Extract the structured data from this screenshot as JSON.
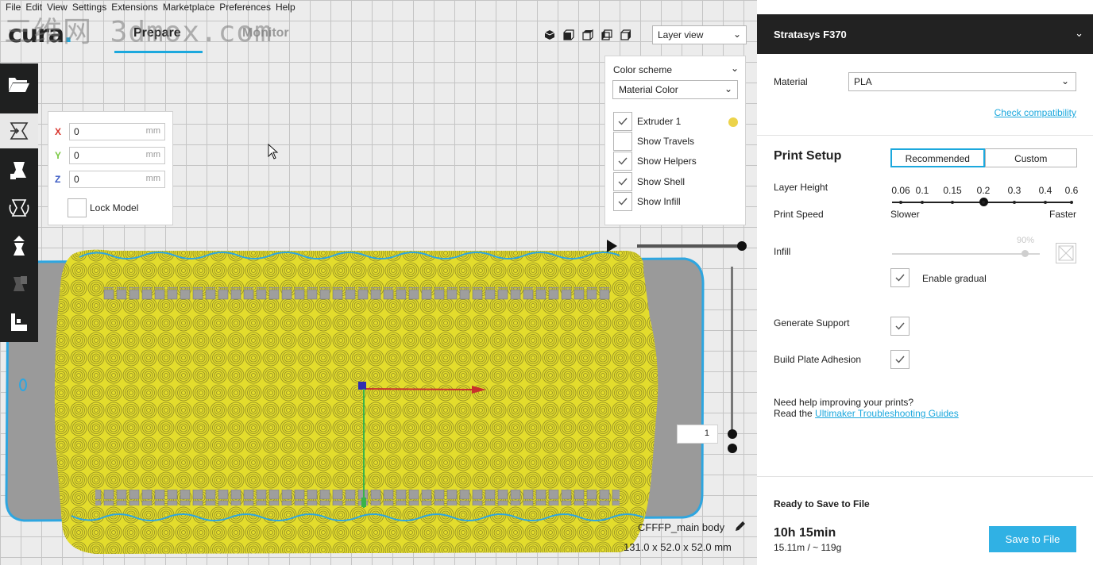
{
  "menu": [
    "File",
    "Edit",
    "View",
    "Settings",
    "Extensions",
    "Marketplace",
    "Preferences",
    "Help"
  ],
  "watermark": "三维网 3dmox.com",
  "header": {
    "logo": "cura",
    "tabs": [
      {
        "label": "Prepare",
        "active": true
      },
      {
        "label": "Monitor",
        "active": false
      }
    ],
    "view_mode": "Layer view",
    "view_buttons": [
      "3d-view-icon",
      "front-view-icon",
      "top-view-icon",
      "left-view-icon",
      "right-view-icon"
    ]
  },
  "toolbar": {
    "items": [
      "open-folder-icon",
      "move-tool-icon",
      "scale-tool-icon",
      "rotate-tool-icon",
      "mirror-tool-icon",
      "per-model-settings-icon",
      "support-blocker-icon"
    ]
  },
  "move_panel": {
    "x": {
      "label": "X",
      "value": "0",
      "unit": "mm",
      "color": "#d8342c"
    },
    "y": {
      "label": "Y",
      "value": "0",
      "unit": "mm",
      "color": "#7ac943"
    },
    "z": {
      "label": "Z",
      "value": "0",
      "unit": "mm",
      "color": "#3b5bc4"
    },
    "lock_label": "Lock Model",
    "lock_checked": false
  },
  "color_scheme": {
    "title": "Color scheme",
    "selected": "Material Color",
    "options": [
      {
        "label": "Extruder 1",
        "checked": true,
        "swatch": "#ecd34a"
      },
      {
        "label": "Show Travels",
        "checked": false
      },
      {
        "label": "Show Helpers",
        "checked": true
      },
      {
        "label": "Show Shell",
        "checked": true
      },
      {
        "label": "Show Infill",
        "checked": true
      }
    ]
  },
  "layer_slider": {
    "current_layer": "1"
  },
  "model": {
    "name": "CFFFP_main body",
    "dimensions": "131.0 x 52.0 x 52.0 mm"
  },
  "sidebar": {
    "machine": "Stratasys F370",
    "material_label": "Material",
    "material_value": "PLA",
    "check_compatibility": "Check compatibility",
    "print_setup_title": "Print Setup",
    "mode_tabs": [
      {
        "label": "Recommended",
        "active": true
      },
      {
        "label": "Custom",
        "active": false
      }
    ],
    "layer_height_label": "Layer Height",
    "layer_heights": [
      "0.06",
      "0.1",
      "0.15",
      "0.2",
      "0.3",
      "0.4",
      "0.6"
    ],
    "layer_height_selected": "0.2",
    "print_speed_label": "Print Speed",
    "slower": "Slower",
    "faster": "Faster",
    "infill_label": "Infill",
    "infill_value": "90%",
    "infill_fraction": 0.9,
    "enable_gradual": "Enable gradual",
    "generate_support": "Generate Support",
    "build_plate_adhesion": "Build Plate Adhesion",
    "help_line_1": "Need help improving your prints?",
    "help_line_2_prefix": "Read the",
    "help_link": "Ultimaker Troubleshooting Guides",
    "ready_label": "Ready to Save to File",
    "print_time": "10h 15min",
    "print_material": "15.11m / ~ 119g",
    "save_button": "Save to File"
  },
  "colors": {
    "accent": "#1ca8dd",
    "toolbar_bg": "#1f2020",
    "machine_header_bg": "#222222",
    "model_yellow": "#e8df2a",
    "model_gray": "#9a9a9a",
    "save_button_bg": "#30b1e4"
  }
}
